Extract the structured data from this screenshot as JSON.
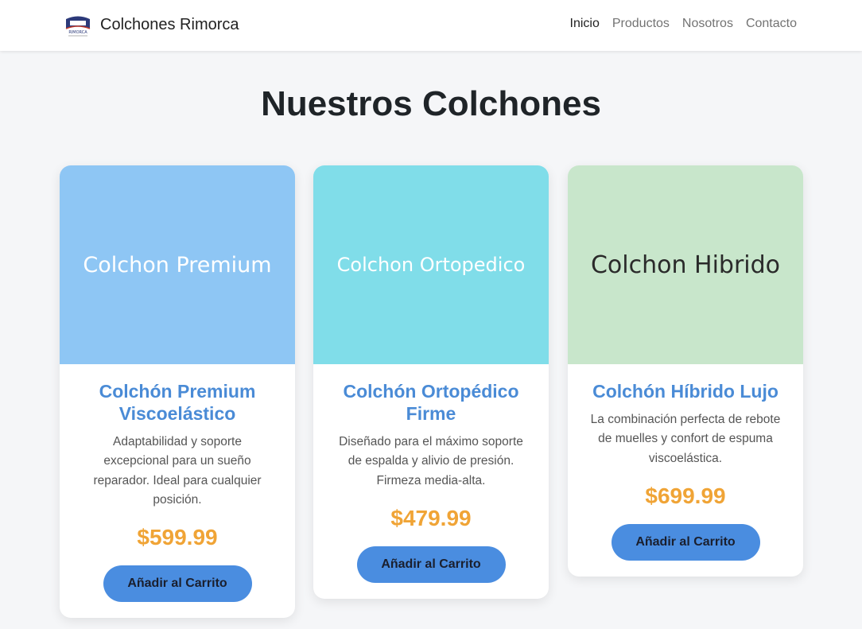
{
  "nav": {
    "brand": "Colchones Rimorca",
    "logo_text": "RIMORCA",
    "links": [
      "Inicio",
      "Productos",
      "Nosotros",
      "Contacto"
    ],
    "active_link": "Inicio"
  },
  "main": {
    "title": "Nuestros Colchones"
  },
  "colors": {
    "title_blue": "#4a8bd6",
    "price_orange": "#f0a436",
    "button_blue": "#4a8de0",
    "card1_image_bg": "#8ec6f4",
    "card2_image_bg": "#80dde9",
    "card3_image_bg": "#c8e6cb"
  },
  "products": [
    {
      "image_text": "Colchon Premium",
      "name": "Colchón Premium Viscoelástico",
      "description": "Adaptabilidad y soporte excepcional para un sueño reparador. Ideal para cualquier posición.",
      "price": "$599.99",
      "button": "Añadir al Carrito"
    },
    {
      "image_text": "Colchon Ortopedico",
      "name": "Colchón Ortopédico Firme",
      "description": "Diseñado para el máximo soporte de espalda y alivio de presión. Firmeza media-alta.",
      "price": "$479.99",
      "button": "Añadir al Carrito"
    },
    {
      "image_text": "Colchon Hibrido",
      "name": "Colchón Híbrido Lujo",
      "description": "La combinación perfecta de rebote de muelles y confort de espuma viscoelástica.",
      "price": "$699.99",
      "button": "Añadir al Carrito"
    }
  ]
}
